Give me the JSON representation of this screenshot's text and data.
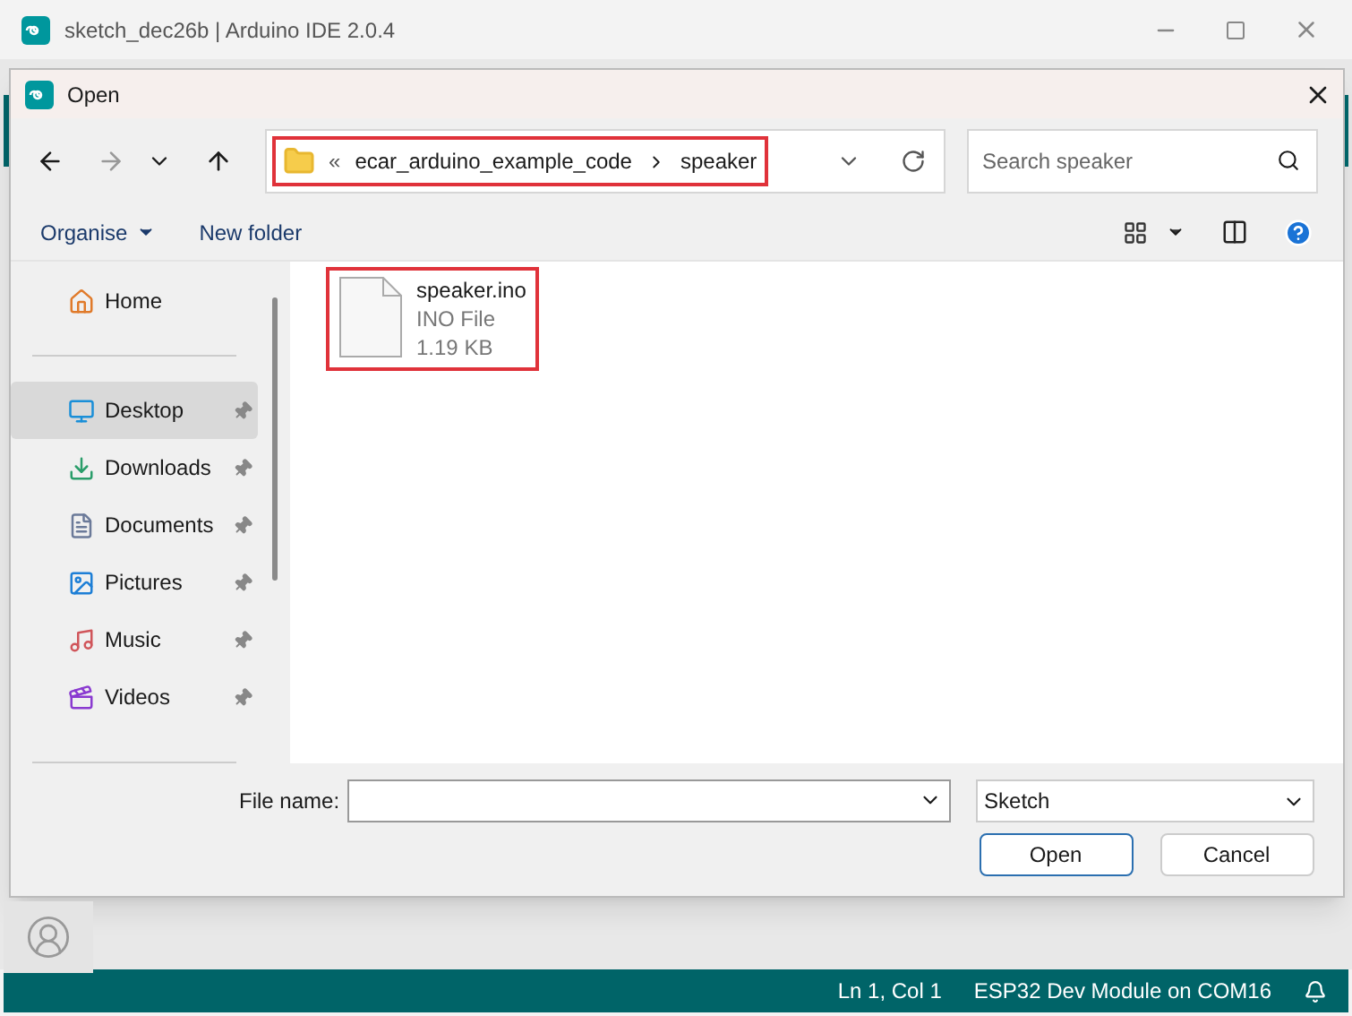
{
  "window": {
    "title": "sketch_dec26b | Arduino IDE 2.0.4"
  },
  "dialog": {
    "title": "Open",
    "address": {
      "overflow": "«",
      "segments": [
        "ecar_arduino_example_code",
        "speaker"
      ],
      "highlighted": true
    },
    "search": {
      "placeholder": "Search speaker"
    },
    "toolbar": {
      "organise": "Organise",
      "new_folder": "New folder"
    },
    "sidebar": {
      "items": [
        {
          "label": "Home",
          "kind": "home",
          "pinned": false,
          "selected": false
        },
        {
          "label": "Desktop",
          "kind": "desktop",
          "pinned": true,
          "selected": true
        },
        {
          "label": "Downloads",
          "kind": "downloads",
          "pinned": true,
          "selected": false
        },
        {
          "label": "Documents",
          "kind": "documents",
          "pinned": true,
          "selected": false
        },
        {
          "label": "Pictures",
          "kind": "pictures",
          "pinned": true,
          "selected": false
        },
        {
          "label": "Music",
          "kind": "music",
          "pinned": true,
          "selected": false
        },
        {
          "label": "Videos",
          "kind": "videos",
          "pinned": true,
          "selected": false
        }
      ]
    },
    "files": [
      {
        "name": "speaker.ino",
        "type": "INO File",
        "size": "1.19 KB",
        "highlighted": true
      }
    ],
    "file_name": {
      "label": "File name:"
    },
    "file_type": "Sketch",
    "buttons": [
      "Open",
      "Cancel"
    ]
  },
  "status_bar": {
    "position": "Ln 1, Col 1",
    "board": "ESP32 Dev Module on COM16"
  }
}
